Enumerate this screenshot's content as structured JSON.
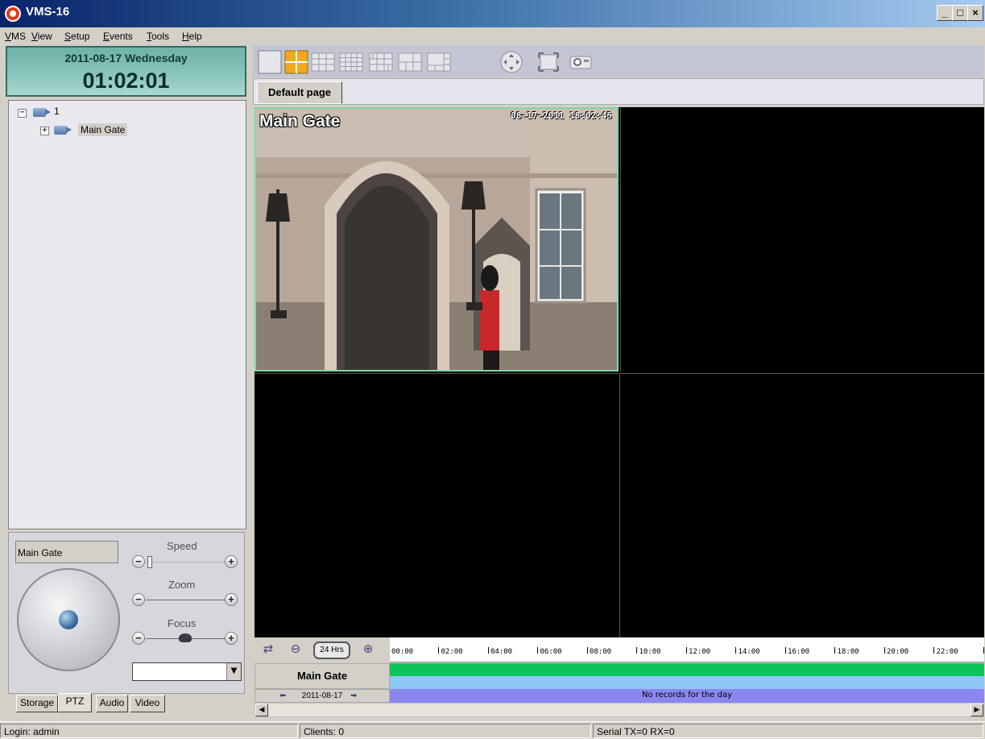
{
  "window": {
    "title": "VMS-16",
    "controls": [
      "_",
      "□",
      "×"
    ]
  },
  "menu": [
    "VMS",
    "View",
    "Setup",
    "Events",
    "Tools",
    "Help"
  ],
  "clock": {
    "date": "2011-08-17 Wednesday",
    "time": "01:02:01"
  },
  "tree": {
    "root_label": "1",
    "camera_label": "Main Gate"
  },
  "toolbar": {
    "icons": [
      "single-view-icon",
      "quad-view-icon",
      "nine-view-icon",
      "sixteen-view-icon",
      "multi-view-icon",
      "six-view-icon",
      "eight-view-icon",
      "ptz-navigation-icon",
      "fullscreen-icon",
      "snapshot-icon"
    ]
  },
  "page_tabs": {
    "default": "Default page"
  },
  "video": {
    "osd_name": "Main Gate",
    "osd_time": "08-17-2011  18:02:45",
    "active_border_color": "#7ed9a6"
  },
  "ptz": {
    "camera": "Main Gate",
    "speed_label": "Speed",
    "zoom_label": "Zoom",
    "focus_label": "Focus",
    "minus": "−",
    "plus": "+",
    "dropdown_value": ""
  },
  "bottom_tabs": [
    "Storage",
    "PTZ",
    "Audio",
    "Video"
  ],
  "timeline": {
    "zoom_label": "24 Hrs",
    "hours": [
      "00:00",
      "02:00",
      "04:00",
      "06:00",
      "08:00",
      "10:00",
      "12:00",
      "14:00",
      "16:00",
      "18:00",
      "20:00",
      "22:00"
    ],
    "camera": "Main Gate",
    "date": "2011-08-17",
    "no_records": "No records for the day",
    "colors": {
      "record": "#0ec45a",
      "motion": "#8ec8f6",
      "day": "#8c86f0"
    }
  },
  "status": {
    "login": "Login: admin",
    "clients": "Clients: 0",
    "serial": "Serial TX=0 RX=0"
  }
}
